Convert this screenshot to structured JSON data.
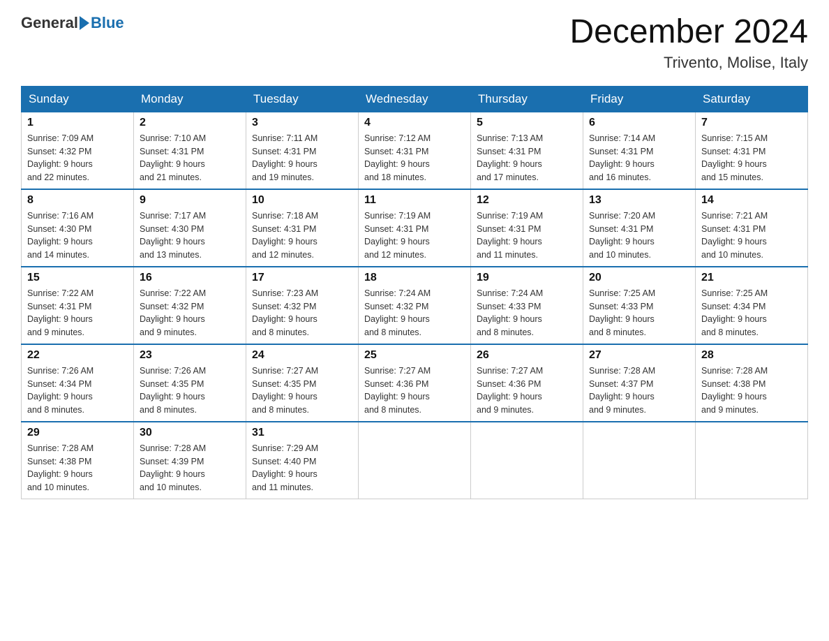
{
  "logo": {
    "general": "General",
    "blue": "Blue"
  },
  "title": {
    "month_year": "December 2024",
    "location": "Trivento, Molise, Italy"
  },
  "weekdays": [
    "Sunday",
    "Monday",
    "Tuesday",
    "Wednesday",
    "Thursday",
    "Friday",
    "Saturday"
  ],
  "weeks": [
    [
      {
        "day": "1",
        "sunrise": "7:09 AM",
        "sunset": "4:32 PM",
        "daylight": "9 hours and 22 minutes."
      },
      {
        "day": "2",
        "sunrise": "7:10 AM",
        "sunset": "4:31 PM",
        "daylight": "9 hours and 21 minutes."
      },
      {
        "day": "3",
        "sunrise": "7:11 AM",
        "sunset": "4:31 PM",
        "daylight": "9 hours and 19 minutes."
      },
      {
        "day": "4",
        "sunrise": "7:12 AM",
        "sunset": "4:31 PM",
        "daylight": "9 hours and 18 minutes."
      },
      {
        "day": "5",
        "sunrise": "7:13 AM",
        "sunset": "4:31 PM",
        "daylight": "9 hours and 17 minutes."
      },
      {
        "day": "6",
        "sunrise": "7:14 AM",
        "sunset": "4:31 PM",
        "daylight": "9 hours and 16 minutes."
      },
      {
        "day": "7",
        "sunrise": "7:15 AM",
        "sunset": "4:31 PM",
        "daylight": "9 hours and 15 minutes."
      }
    ],
    [
      {
        "day": "8",
        "sunrise": "7:16 AM",
        "sunset": "4:30 PM",
        "daylight": "9 hours and 14 minutes."
      },
      {
        "day": "9",
        "sunrise": "7:17 AM",
        "sunset": "4:30 PM",
        "daylight": "9 hours and 13 minutes."
      },
      {
        "day": "10",
        "sunrise": "7:18 AM",
        "sunset": "4:31 PM",
        "daylight": "9 hours and 12 minutes."
      },
      {
        "day": "11",
        "sunrise": "7:19 AM",
        "sunset": "4:31 PM",
        "daylight": "9 hours and 12 minutes."
      },
      {
        "day": "12",
        "sunrise": "7:19 AM",
        "sunset": "4:31 PM",
        "daylight": "9 hours and 11 minutes."
      },
      {
        "day": "13",
        "sunrise": "7:20 AM",
        "sunset": "4:31 PM",
        "daylight": "9 hours and 10 minutes."
      },
      {
        "day": "14",
        "sunrise": "7:21 AM",
        "sunset": "4:31 PM",
        "daylight": "9 hours and 10 minutes."
      }
    ],
    [
      {
        "day": "15",
        "sunrise": "7:22 AM",
        "sunset": "4:31 PM",
        "daylight": "9 hours and 9 minutes."
      },
      {
        "day": "16",
        "sunrise": "7:22 AM",
        "sunset": "4:32 PM",
        "daylight": "9 hours and 9 minutes."
      },
      {
        "day": "17",
        "sunrise": "7:23 AM",
        "sunset": "4:32 PM",
        "daylight": "9 hours and 8 minutes."
      },
      {
        "day": "18",
        "sunrise": "7:24 AM",
        "sunset": "4:32 PM",
        "daylight": "9 hours and 8 minutes."
      },
      {
        "day": "19",
        "sunrise": "7:24 AM",
        "sunset": "4:33 PM",
        "daylight": "9 hours and 8 minutes."
      },
      {
        "day": "20",
        "sunrise": "7:25 AM",
        "sunset": "4:33 PM",
        "daylight": "9 hours and 8 minutes."
      },
      {
        "day": "21",
        "sunrise": "7:25 AM",
        "sunset": "4:34 PM",
        "daylight": "9 hours and 8 minutes."
      }
    ],
    [
      {
        "day": "22",
        "sunrise": "7:26 AM",
        "sunset": "4:34 PM",
        "daylight": "9 hours and 8 minutes."
      },
      {
        "day": "23",
        "sunrise": "7:26 AM",
        "sunset": "4:35 PM",
        "daylight": "9 hours and 8 minutes."
      },
      {
        "day": "24",
        "sunrise": "7:27 AM",
        "sunset": "4:35 PM",
        "daylight": "9 hours and 8 minutes."
      },
      {
        "day": "25",
        "sunrise": "7:27 AM",
        "sunset": "4:36 PM",
        "daylight": "9 hours and 8 minutes."
      },
      {
        "day": "26",
        "sunrise": "7:27 AM",
        "sunset": "4:36 PM",
        "daylight": "9 hours and 9 minutes."
      },
      {
        "day": "27",
        "sunrise": "7:28 AM",
        "sunset": "4:37 PM",
        "daylight": "9 hours and 9 minutes."
      },
      {
        "day": "28",
        "sunrise": "7:28 AM",
        "sunset": "4:38 PM",
        "daylight": "9 hours and 9 minutes."
      }
    ],
    [
      {
        "day": "29",
        "sunrise": "7:28 AM",
        "sunset": "4:38 PM",
        "daylight": "9 hours and 10 minutes."
      },
      {
        "day": "30",
        "sunrise": "7:28 AM",
        "sunset": "4:39 PM",
        "daylight": "9 hours and 10 minutes."
      },
      {
        "day": "31",
        "sunrise": "7:29 AM",
        "sunset": "4:40 PM",
        "daylight": "9 hours and 11 minutes."
      },
      null,
      null,
      null,
      null
    ]
  ],
  "labels": {
    "sunrise": "Sunrise:",
    "sunset": "Sunset:",
    "daylight": "Daylight:"
  }
}
